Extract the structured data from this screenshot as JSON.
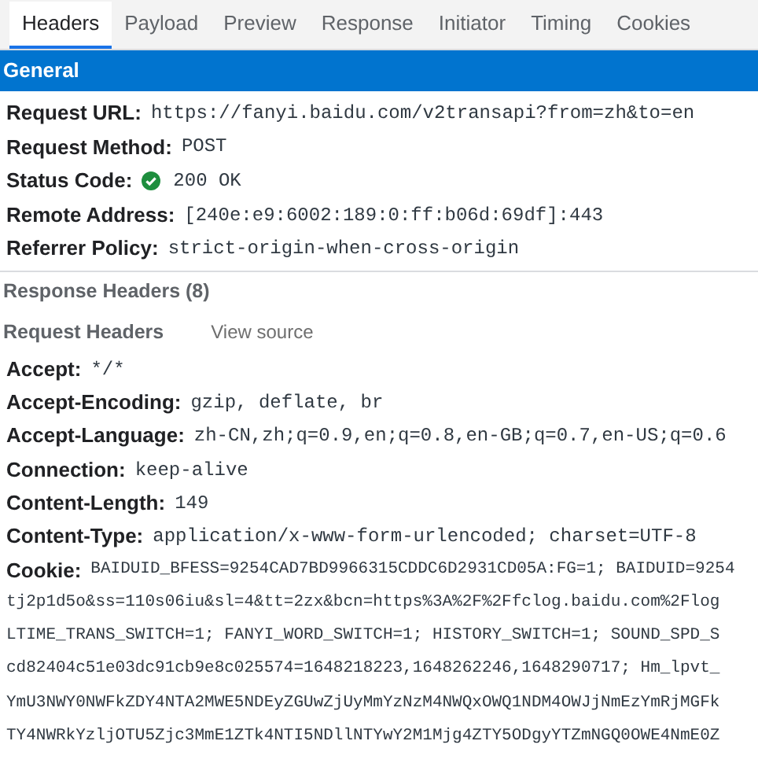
{
  "tabs": [
    {
      "label": "Headers",
      "selected": true
    },
    {
      "label": "Payload",
      "selected": false
    },
    {
      "label": "Preview",
      "selected": false
    },
    {
      "label": "Response",
      "selected": false
    },
    {
      "label": "Initiator",
      "selected": false
    },
    {
      "label": "Timing",
      "selected": false
    },
    {
      "label": "Cookies",
      "selected": false
    }
  ],
  "general": {
    "title": "General",
    "rows": [
      {
        "name": "Request URL:",
        "value": "https://fanyi.baidu.com/v2transapi?from=zh&to=en"
      },
      {
        "name": "Request Method:",
        "value": "POST"
      },
      {
        "name": "Status Code:",
        "value": "200 OK",
        "kind": "status"
      },
      {
        "name": "Remote Address:",
        "value": "[240e:e9:6002:189:0:ff:b06d:69df]:443"
      },
      {
        "name": "Referrer Policy:",
        "value": "strict-origin-when-cross-origin"
      }
    ]
  },
  "response_headers": {
    "title": "Response Headers (8)"
  },
  "request_headers": {
    "title": "Request Headers",
    "link": "View source",
    "rows": [
      {
        "name": "Accept:",
        "value": "*/*"
      },
      {
        "name": "Accept-Encoding:",
        "value": "gzip, deflate, br"
      },
      {
        "name": "Accept-Language:",
        "value": "zh-CN,zh;q=0.9,en;q=0.8,en-GB;q=0.7,en-US;q=0.6"
      },
      {
        "name": "Connection:",
        "value": "keep-alive"
      },
      {
        "name": "Content-Length:",
        "value": "149"
      },
      {
        "name": "Content-Type:",
        "value": "application/x-www-form-urlencoded; charset=UTF-8"
      },
      {
        "name": "Cookie:",
        "value": "BAIDUID_BFESS=9254CAD7BD9966315CDDC6D2931CD05A:FG=1; BAIDUID=9254",
        "continuation": [
          "tj2p1d5o&ss=110s06iu&sl=4&tt=2zx&bcn=https%3A%2F%2Ffclog.baidu.com%2Flog",
          "LTIME_TRANS_SWITCH=1; FANYI_WORD_SWITCH=1; HISTORY_SWITCH=1; SOUND_SPD_S",
          "cd82404c51e03dc91cb9e8c025574=1648218223,1648262246,1648290717; Hm_lpvt_",
          "YmU3NWY0NWFkZDY4NTA2MWE5NDEyZGUwZjUyMmYzNzM4NWQxOWQ1NDM4OWJjNmEzYmRjMGFk",
          "TY4NWRkYzljOTU5Zjc3MmE1ZTk4NTI5NDllNTYwY2M1Mjg4ZTY5ODgyYTZmNGQ0OWE4NmE0Z"
        ]
      }
    ]
  }
}
